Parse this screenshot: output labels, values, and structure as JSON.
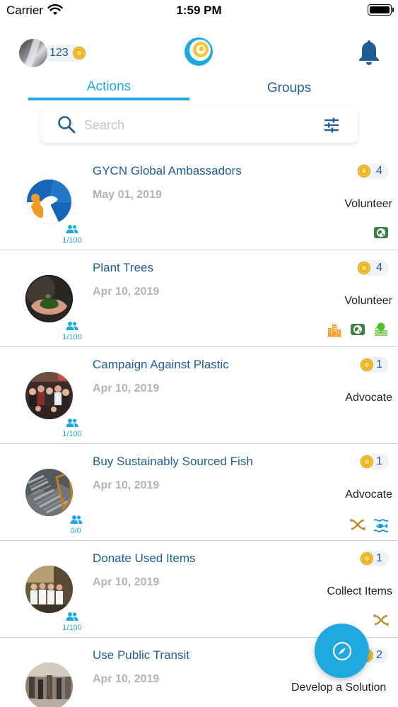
{
  "status_bar": {
    "carrier": "Carrier",
    "time": "1:59 PM"
  },
  "header": {
    "coin_count": "123"
  },
  "tabs": {
    "actions": "Actions",
    "groups": "Groups",
    "active": "Actions"
  },
  "search": {
    "placeholder": "Search",
    "value": ""
  },
  "actions": [
    {
      "title": "GYCN Global Ambassadors",
      "date": "May 01, 2019",
      "points": "4",
      "type": "Volunteer",
      "members": "1/100",
      "sdg_icons": [
        "climate-action-icon"
      ]
    },
    {
      "title": "Plant Trees",
      "date": "Apr 10, 2019",
      "points": "4",
      "type": "Volunteer",
      "members": "1/100",
      "sdg_icons": [
        "sustainable-cities-icon",
        "climate-action-icon",
        "life-on-land-icon"
      ]
    },
    {
      "title": "Campaign Against Plastic",
      "date": "Apr 10, 2019",
      "points": "1",
      "type": "Advocate",
      "members": "1/100",
      "sdg_icons": []
    },
    {
      "title": "Buy Sustainably Sourced Fish",
      "date": "Apr 10, 2019",
      "points": "1",
      "type": "Advocate",
      "members": "0/0",
      "sdg_icons": [
        "responsible-consumption-icon",
        "life-below-water-icon"
      ]
    },
    {
      "title": "Donate Used Items",
      "date": "Apr 10, 2019",
      "points": "1",
      "type": "Collect Items",
      "members": "1/100",
      "sdg_icons": [
        "responsible-consumption-icon"
      ]
    },
    {
      "title": "Use Public Transit",
      "date": "Apr 10, 2019",
      "points": "2",
      "type": "",
      "members": "",
      "sdg_icons": []
    }
  ],
  "fab": {
    "label": "Develop a Solution"
  },
  "colors": {
    "accent": "#1ea9e1",
    "title": "#1f5d96",
    "date": "#b3b3b3",
    "coin": "#e9b21d"
  }
}
